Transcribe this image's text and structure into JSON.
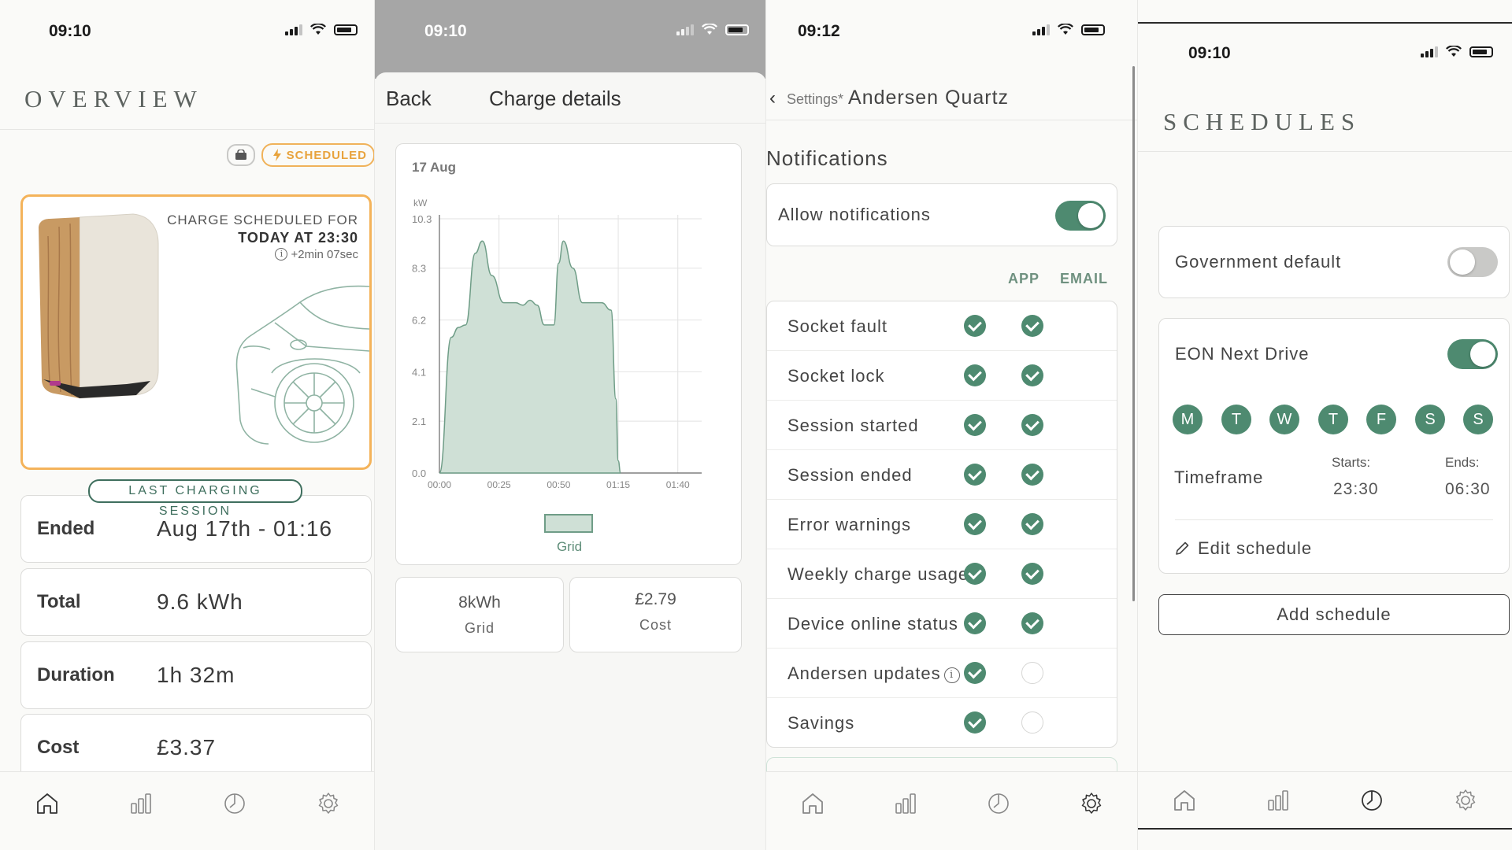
{
  "overview": {
    "time": "09:10",
    "heading": "OVERVIEW",
    "scheduled_pill": "SCHEDULED",
    "charge_line1": "CHARGE SCHEDULED FOR",
    "charge_line2": "TODAY AT 23:30",
    "charge_line3": "+2min 07sec",
    "session_label": "LAST CHARGING SESSION",
    "stats": [
      {
        "label": "Ended",
        "value": "Aug 17th - 01:16"
      },
      {
        "label": "Total",
        "value": "9.6 kWh"
      },
      {
        "label": "Duration",
        "value": "1h 32m"
      },
      {
        "label": "Cost",
        "value": "£3.37"
      }
    ]
  },
  "details": {
    "time": "09:10",
    "back": "Back",
    "title": "Charge details",
    "date": "17 Aug",
    "legend": "Grid",
    "grid_value": "8kWh",
    "grid_label": "Grid",
    "cost_value": "£2.79",
    "cost_label": "Cost"
  },
  "chart_data": {
    "type": "area",
    "ylabel": "kW",
    "ylim": [
      0.0,
      10.3
    ],
    "y_ticks": [
      "0.0",
      "2.1",
      "4.1",
      "6.2",
      "8.3",
      "10.3"
    ],
    "x_ticks": [
      "00:00",
      "00:25",
      "00:50",
      "01:15",
      "01:40"
    ],
    "series": [
      {
        "name": "Grid",
        "x_minutes": [
          0,
          5,
          8,
          11,
          15,
          18,
          22,
          27,
          32,
          35,
          38,
          41,
          44,
          48,
          50,
          52,
          56,
          60,
          68,
          72,
          74,
          75,
          76
        ],
        "values": [
          0.0,
          5.5,
          5.9,
          6.0,
          8.9,
          9.4,
          8.0,
          6.9,
          6.9,
          6.8,
          7.0,
          6.8,
          6.0,
          6.0,
          8.5,
          9.4,
          8.3,
          6.9,
          6.9,
          6.6,
          3.0,
          0.5,
          0.0
        ]
      }
    ]
  },
  "settings": {
    "time": "09:12",
    "crumb_parent": "Settings*",
    "crumb_device": "Andersen Quartz",
    "section": "Notifications",
    "allow_label": "Allow notifications",
    "col_app": "APP",
    "col_email": "EMAIL",
    "rows": [
      {
        "label": "Socket fault",
        "app": true,
        "email": true
      },
      {
        "label": "Socket lock",
        "app": true,
        "email": true
      },
      {
        "label": "Session started",
        "app": true,
        "email": true
      },
      {
        "label": "Session ended",
        "app": true,
        "email": true
      },
      {
        "label": "Error warnings",
        "app": true,
        "email": true
      },
      {
        "label": "Weekly charge usage",
        "app": true,
        "email": true
      },
      {
        "label": "Device online status",
        "app": true,
        "email": true
      },
      {
        "label": "Andersen updates",
        "app": true,
        "email": false
      },
      {
        "label": "Savings",
        "app": true,
        "email": false
      }
    ]
  },
  "schedules": {
    "time": "09:10",
    "heading": "SCHEDULES",
    "gov_label": "Government default",
    "gov_enabled": false,
    "eon_label": "EON Next Drive",
    "eon_enabled": true,
    "days": [
      "M",
      "T",
      "W",
      "T",
      "F",
      "S",
      "S"
    ],
    "timeframe_label": "Timeframe",
    "starts_label": "Starts:",
    "starts_value": "23:30",
    "ends_label": "Ends:",
    "ends_value": "06:30",
    "edit_label": "Edit schedule",
    "add_label": "Add schedule"
  },
  "colors": {
    "accent_green": "#4e8a70",
    "scheduled_orange": "#f0b25a",
    "chart_fill": "#cfe0d6"
  },
  "icons": {
    "tabbar": [
      "home-icon",
      "stats-icon",
      "schedule-icon",
      "settings-icon"
    ],
    "status": [
      "signal-icon",
      "wifi-icon",
      "battery-icon"
    ]
  }
}
